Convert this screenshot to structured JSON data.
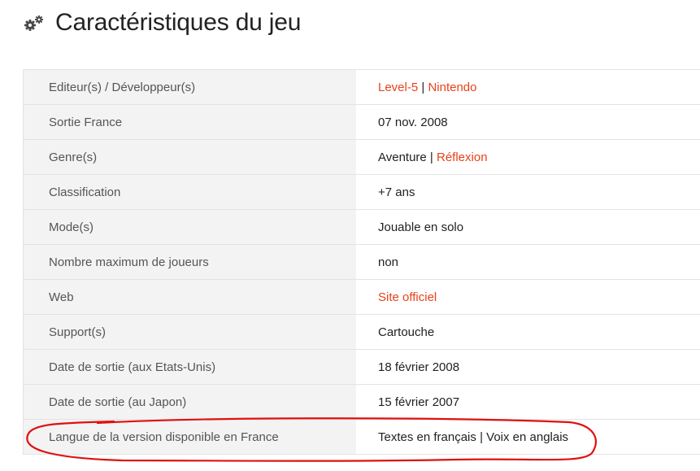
{
  "page_title": "Caractéristiques du jeu",
  "header_icon": "gears-icon",
  "colors": {
    "link": "#e8421b",
    "label_bg": "#f3f3f3",
    "annotation": "#e01010"
  },
  "rows": [
    {
      "label": "Editeur(s) / Développeur(s)",
      "parts": [
        {
          "text": "Level-5",
          "link": true
        },
        {
          "text": "Nintendo",
          "link": true
        }
      ]
    },
    {
      "label": "Sortie France",
      "parts": [
        {
          "text": "07 nov. 2008",
          "link": false
        }
      ]
    },
    {
      "label": "Genre(s)",
      "parts": [
        {
          "text": "Aventure",
          "link": false
        },
        {
          "text": "Réflexion",
          "link": true
        }
      ]
    },
    {
      "label": "Classification",
      "parts": [
        {
          "text": "+7 ans",
          "link": false
        }
      ]
    },
    {
      "label": "Mode(s)",
      "parts": [
        {
          "text": "Jouable en solo",
          "link": false
        }
      ]
    },
    {
      "label": "Nombre maximum de joueurs",
      "parts": [
        {
          "text": "non",
          "link": false
        }
      ]
    },
    {
      "label": "Web",
      "parts": [
        {
          "text": "Site officiel",
          "link": true
        }
      ]
    },
    {
      "label": "Support(s)",
      "parts": [
        {
          "text": "Cartouche",
          "link": false
        }
      ]
    },
    {
      "label": "Date de sortie (aux Etats-Unis)",
      "parts": [
        {
          "text": "18 février 2008",
          "link": false
        }
      ]
    },
    {
      "label": "Date de sortie (au Japon)",
      "parts": [
        {
          "text": "15 février 2007",
          "link": false
        }
      ]
    },
    {
      "label": "Langue de la version disponible en France",
      "parts": [
        {
          "text": "Textes en français",
          "link": false
        },
        {
          "text": "Voix en anglais",
          "link": false
        }
      ]
    }
  ],
  "separator": " | "
}
